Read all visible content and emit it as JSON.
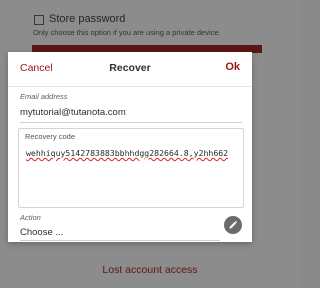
{
  "background": {
    "store_password_label": "Store password",
    "store_password_hint": "Only choose this option if you are using a private device.",
    "lost_access_link": "Lost account access"
  },
  "dialog": {
    "cancel_label": "Cancel",
    "title": "Recover",
    "ok_label": "Ok",
    "email": {
      "label": "Email address",
      "value": "mytutorial@tutanota.com"
    },
    "recovery_code": {
      "label": "Recovery code",
      "value": "wehhiquy5142783883bbhhdgg282664.8,y2hh662"
    },
    "action": {
      "label": "Action",
      "selected": "Choose ..."
    },
    "edit_icon": "pencil-icon"
  },
  "colors": {
    "accent": "#a01717",
    "overlay": "#8c8c8c",
    "dialog_bg": "#ffffff",
    "edit_button": "#6b6b6b"
  }
}
